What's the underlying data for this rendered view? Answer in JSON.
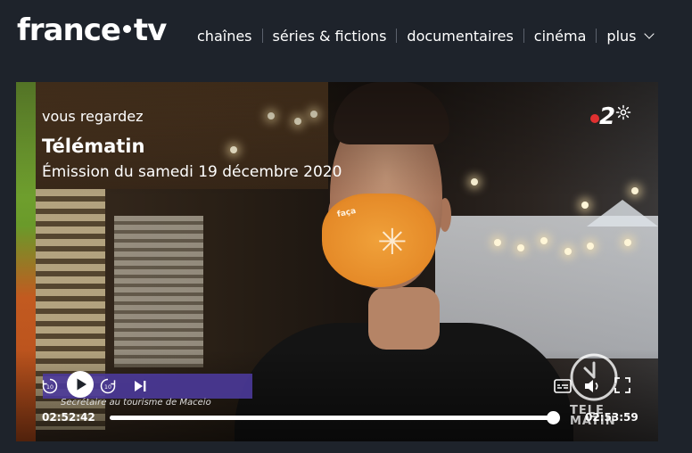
{
  "header": {
    "logo_left": "france",
    "logo_right": "tv",
    "nav": [
      {
        "label": "chaînes"
      },
      {
        "label": "séries & fictions"
      },
      {
        "label": "documentaires"
      },
      {
        "label": "cinéma"
      },
      {
        "label": "plus"
      }
    ]
  },
  "player": {
    "now_watching": "vous regardez",
    "title": "Télématin",
    "subtitle": "Émission du samedi 19 décembre 2020",
    "channel_number": "2",
    "mask_text": "faça",
    "lower_third_caption": "Secrétaire au tourisme de Maceio",
    "watermark": [
      "TELE",
      "MATIN"
    ],
    "current_time": "02:52:42",
    "end_time": "02:53:59",
    "progress": 0.9833,
    "icons": {
      "rewind": "rewind-10-icon",
      "play": "play-icon",
      "forward": "forward-10-icon",
      "next": "next-icon",
      "subtitles": "subtitles-icon",
      "volume": "volume-icon",
      "fullscreen": "fullscreen-icon",
      "settings": "gear-icon"
    }
  }
}
